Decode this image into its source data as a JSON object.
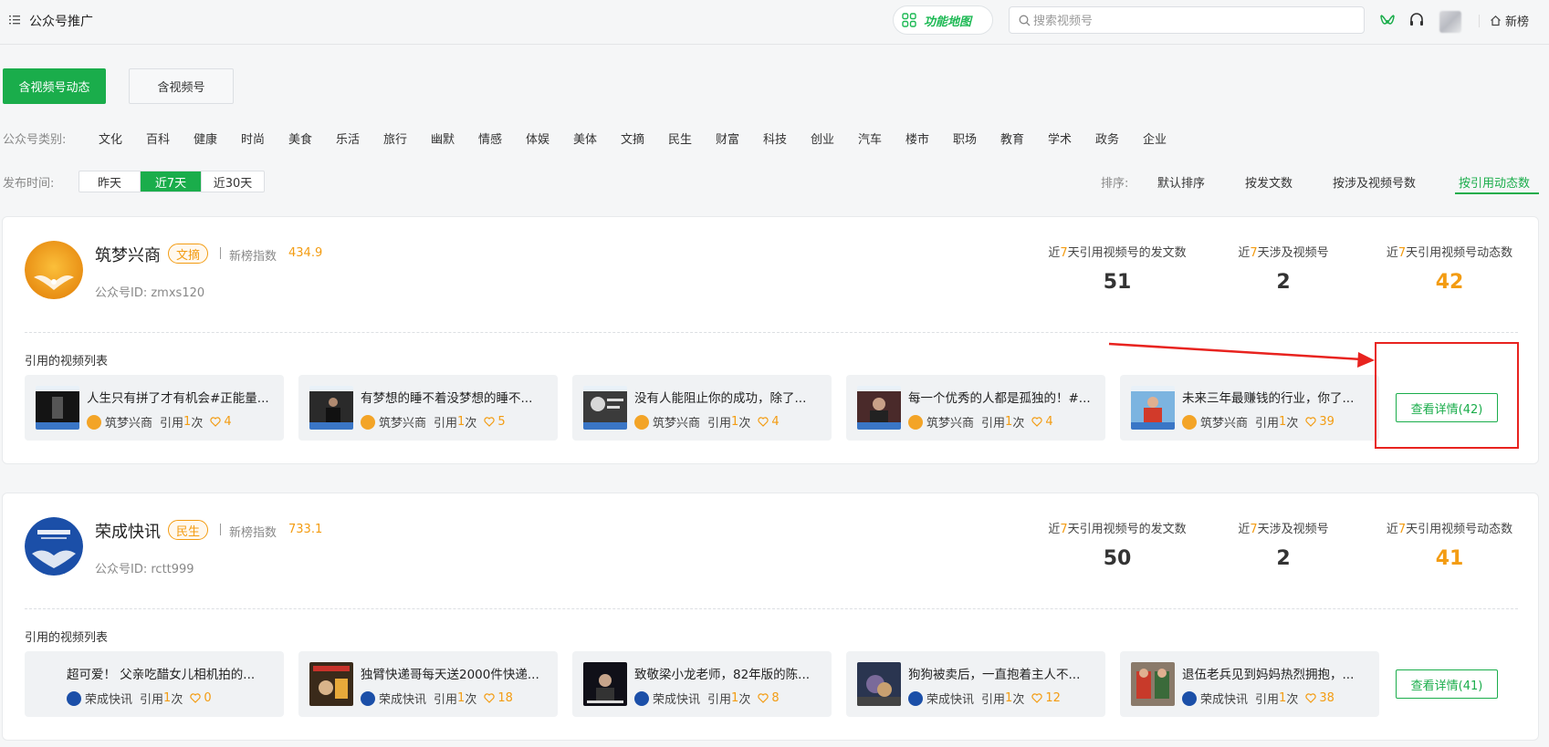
{
  "header": {
    "title": "公众号推广",
    "feature_map_label": "功能地图",
    "search_placeholder": "搜索视频号",
    "brand_label": "新榜"
  },
  "tabs": [
    {
      "label": "含视频号动态",
      "active": true
    },
    {
      "label": "含视频号",
      "active": false
    }
  ],
  "categories": {
    "label": "公众号类别:",
    "items": [
      "文化",
      "百科",
      "健康",
      "时尚",
      "美食",
      "乐活",
      "旅行",
      "幽默",
      "情感",
      "体娱",
      "美体",
      "文摘",
      "民生",
      "财富",
      "科技",
      "创业",
      "汽车",
      "楼市",
      "职场",
      "教育",
      "学术",
      "政务",
      "企业"
    ]
  },
  "time_filter": {
    "label": "发布时间:",
    "options": [
      "昨天",
      "近7天",
      "近30天"
    ],
    "selected": "近7天"
  },
  "sort": {
    "label": "排序:",
    "options": [
      "默认排序",
      "按发文数",
      "按涉及视频号数",
      "按引用动态数"
    ],
    "selected": "按引用动态数"
  },
  "stat_labels": {
    "prefix": "近",
    "days": "7",
    "articles_suffix": "天引用视频号的发文数",
    "channels_suffix": "天涉及视频号",
    "dynamics_suffix": "天引用视频号动态数"
  },
  "meta_labels": {
    "index_label": "新榜指数",
    "id_prefix": "公众号ID: ",
    "list_title": "引用的视频列表",
    "cite_prefix": "引用",
    "cite_suffix": "次"
  },
  "accounts": [
    {
      "name": "筑梦兴商",
      "tag": "文摘",
      "index": "434.9",
      "id": "zmxs120",
      "articles": "51",
      "channels": "2",
      "dynamics": "42",
      "detail_label": "查看详情(42)",
      "logo_text": "筑梦兴商",
      "videos": [
        {
          "title": "人生只有拼了才有机会#正能量...",
          "author": "筑梦兴商",
          "cites": "1",
          "likes": "4"
        },
        {
          "title": "有梦想的睡不着没梦想的睡不...",
          "author": "筑梦兴商",
          "cites": "1",
          "likes": "5"
        },
        {
          "title": "没有人能阻止你的成功，除了...",
          "author": "筑梦兴商",
          "cites": "1",
          "likes": "4"
        },
        {
          "title": "每一个优秀的人都是孤独的！#...",
          "author": "筑梦兴商",
          "cites": "1",
          "likes": "4"
        },
        {
          "title": "未来三年最赚钱的行业，你了...",
          "author": "筑梦兴商",
          "cites": "1",
          "likes": "39"
        }
      ]
    },
    {
      "name": "荣成快讯",
      "tag": "民生",
      "index": "733.1",
      "id": "rctt999",
      "articles": "50",
      "channels": "2",
      "dynamics": "41",
      "detail_label": "查看详情(41)",
      "logo_text": "荣成快讯",
      "videos": [
        {
          "title": "超可爱！ 父亲吃醋女儿相机拍的...",
          "author": "荣成快讯",
          "cites": "1",
          "likes": "0"
        },
        {
          "title": "独臂快递哥每天送2000件快递...",
          "author": "荣成快讯",
          "cites": "1",
          "likes": "18"
        },
        {
          "title": "致敬梁小龙老师，82年版的陈...",
          "author": "荣成快讯",
          "cites": "1",
          "likes": "8"
        },
        {
          "title": "狗狗被卖后，一直抱着主人不...",
          "author": "荣成快讯",
          "cites": "1",
          "likes": "12"
        },
        {
          "title": "退伍老兵见到妈妈热烈拥抱，...",
          "author": "荣成快讯",
          "cites": "1",
          "likes": "38"
        }
      ]
    }
  ],
  "colors": {
    "accent": "#1aad4b",
    "orange": "#f39c12",
    "annotation_red": "#e8231f"
  }
}
